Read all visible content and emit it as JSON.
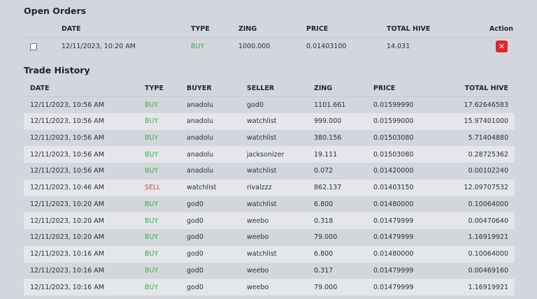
{
  "open_orders": {
    "title": "Open Orders",
    "headers": {
      "date": "DATE",
      "type": "TYPE",
      "zing": "ZING",
      "price": "PRICE",
      "total_hive": "TOTAL HIVE",
      "action": "Action"
    },
    "rows": [
      {
        "date": "12/11/2023, 10:20 AM",
        "type": "BUY",
        "zing": "1000.000",
        "price": "0.01403100",
        "total_hive": "14.031",
        "action_icon": "close-icon"
      }
    ]
  },
  "trade_history": {
    "title": "Trade History",
    "headers": {
      "date": "DATE",
      "type": "TYPE",
      "buyer": "BUYER",
      "seller": "SELLER",
      "zing": "ZING",
      "price": "PRICE",
      "total_hive": "TOTAL HIVE"
    },
    "rows": [
      {
        "date": "12/11/2023, 10:56 AM",
        "type": "BUY",
        "buyer": "anadolu",
        "seller": "god0",
        "zing": "1101.661",
        "price": "0.01599990",
        "total_hive": "17.62646583"
      },
      {
        "date": "12/11/2023, 10:56 AM",
        "type": "BUY",
        "buyer": "anadolu",
        "seller": "watchlist",
        "zing": "999.000",
        "price": "0.01599000",
        "total_hive": "15.97401000"
      },
      {
        "date": "12/11/2023, 10:56 AM",
        "type": "BUY",
        "buyer": "anadolu",
        "seller": "watchlist",
        "zing": "380.156",
        "price": "0.01503080",
        "total_hive": "5.71404880"
      },
      {
        "date": "12/11/2023, 10:56 AM",
        "type": "BUY",
        "buyer": "anadolu",
        "seller": "jacksonizer",
        "zing": "19.111",
        "price": "0.01503080",
        "total_hive": "0.28725362"
      },
      {
        "date": "12/11/2023, 10:56 AM",
        "type": "BUY",
        "buyer": "anadolu",
        "seller": "watchlist",
        "zing": "0.072",
        "price": "0.01420000",
        "total_hive": "0.00102240"
      },
      {
        "date": "12/11/2023, 10:46 AM",
        "type": "SELL",
        "buyer": "watchlist",
        "seller": "rivalzzz",
        "zing": "862.137",
        "price": "0.01403150",
        "total_hive": "12.09707532"
      },
      {
        "date": "12/11/2023, 10:20 AM",
        "type": "BUY",
        "buyer": "god0",
        "seller": "watchlist",
        "zing": "6.800",
        "price": "0.01480000",
        "total_hive": "0.10064000"
      },
      {
        "date": "12/11/2023, 10:20 AM",
        "type": "BUY",
        "buyer": "god0",
        "seller": "weebo",
        "zing": "0.318",
        "price": "0.01479999",
        "total_hive": "0.00470640"
      },
      {
        "date": "12/11/2023, 10:20 AM",
        "type": "BUY",
        "buyer": "god0",
        "seller": "weebo",
        "zing": "79.000",
        "price": "0.01479999",
        "total_hive": "1.16919921"
      },
      {
        "date": "12/11/2023, 10:16 AM",
        "type": "BUY",
        "buyer": "god0",
        "seller": "watchlist",
        "zing": "6.800",
        "price": "0.01480000",
        "total_hive": "0.10064000"
      },
      {
        "date": "12/11/2023, 10:16 AM",
        "type": "BUY",
        "buyer": "god0",
        "seller": "weebo",
        "zing": "0.317",
        "price": "0.01479999",
        "total_hive": "0.00469160"
      },
      {
        "date": "12/11/2023, 10:16 AM",
        "type": "BUY",
        "buyer": "god0",
        "seller": "weebo",
        "zing": "79.000",
        "price": "0.01479999",
        "total_hive": "1.16919921"
      }
    ]
  },
  "colors": {
    "background": "#d3d6dc",
    "stripe": "#e4e6ea",
    "buy": "#34b24a",
    "sell": "#e5484d",
    "cancel_button": "#e0262c"
  }
}
